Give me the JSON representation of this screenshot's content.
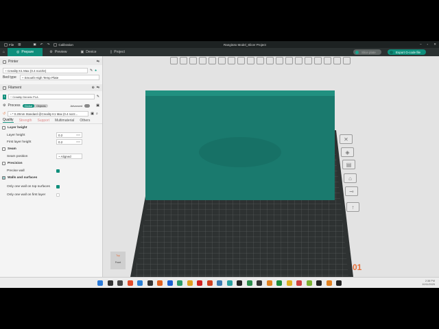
{
  "titlebar": {
    "file": "File",
    "calibration": "Calibration",
    "title": "Rangitoto Model_Slicer Project"
  },
  "tabs": [
    {
      "label": "Prepare"
    },
    {
      "label": "Preview"
    },
    {
      "label": "Device"
    },
    {
      "label": "Project"
    }
  ],
  "actions": {
    "slice": "Slice plate",
    "export": "Export G-code file"
  },
  "printer": {
    "heading": "Printer",
    "preset": "~ Creality K1 Max (0.4 nozzle)",
    "bed_label": "Bed type",
    "bed_value": "~ Smooth High Temp Plate"
  },
  "filament": {
    "heading": "Filament",
    "index": "1",
    "preset": "~ Creality Generic PLA"
  },
  "process": {
    "heading": "Process",
    "toggle_global": "Global",
    "toggle_objects": "Objects",
    "advanced": "Advanced",
    "preset": "~ * 0.20mm Standard @Creality K1 Max (0.4 nozz..."
  },
  "quality_tabs": [
    "Quality",
    "Strength",
    "Support",
    "Multimaterial",
    "Others"
  ],
  "groups": {
    "layer": {
      "title": "Layer height",
      "layer_height_label": "Layer height",
      "layer_height": "0.2",
      "first_label": "First layer height",
      "first": "0.2",
      "unit": "mm"
    },
    "seam": {
      "title": "Seam",
      "pos_label": "Seam position",
      "pos": "~ Aligned"
    },
    "precision": {
      "title": "Precision",
      "precise_label": "Precise wall",
      "precise": true
    },
    "walls": {
      "title": "Walls and surfaces",
      "top_label": "Only one wall on top surfaces",
      "top": true,
      "first_label": "Only one wall on first layer",
      "first": false
    }
  },
  "viewport": {
    "plate_number": "01",
    "navcube_top": "Top",
    "navcube_front": "Front"
  },
  "taskbar": {
    "time": "2:38 PM",
    "date": "10/11/2025"
  },
  "colors": {
    "accent": "#0f8f7c",
    "model": "#1a7a6e",
    "plate_num": "#e5703a"
  }
}
